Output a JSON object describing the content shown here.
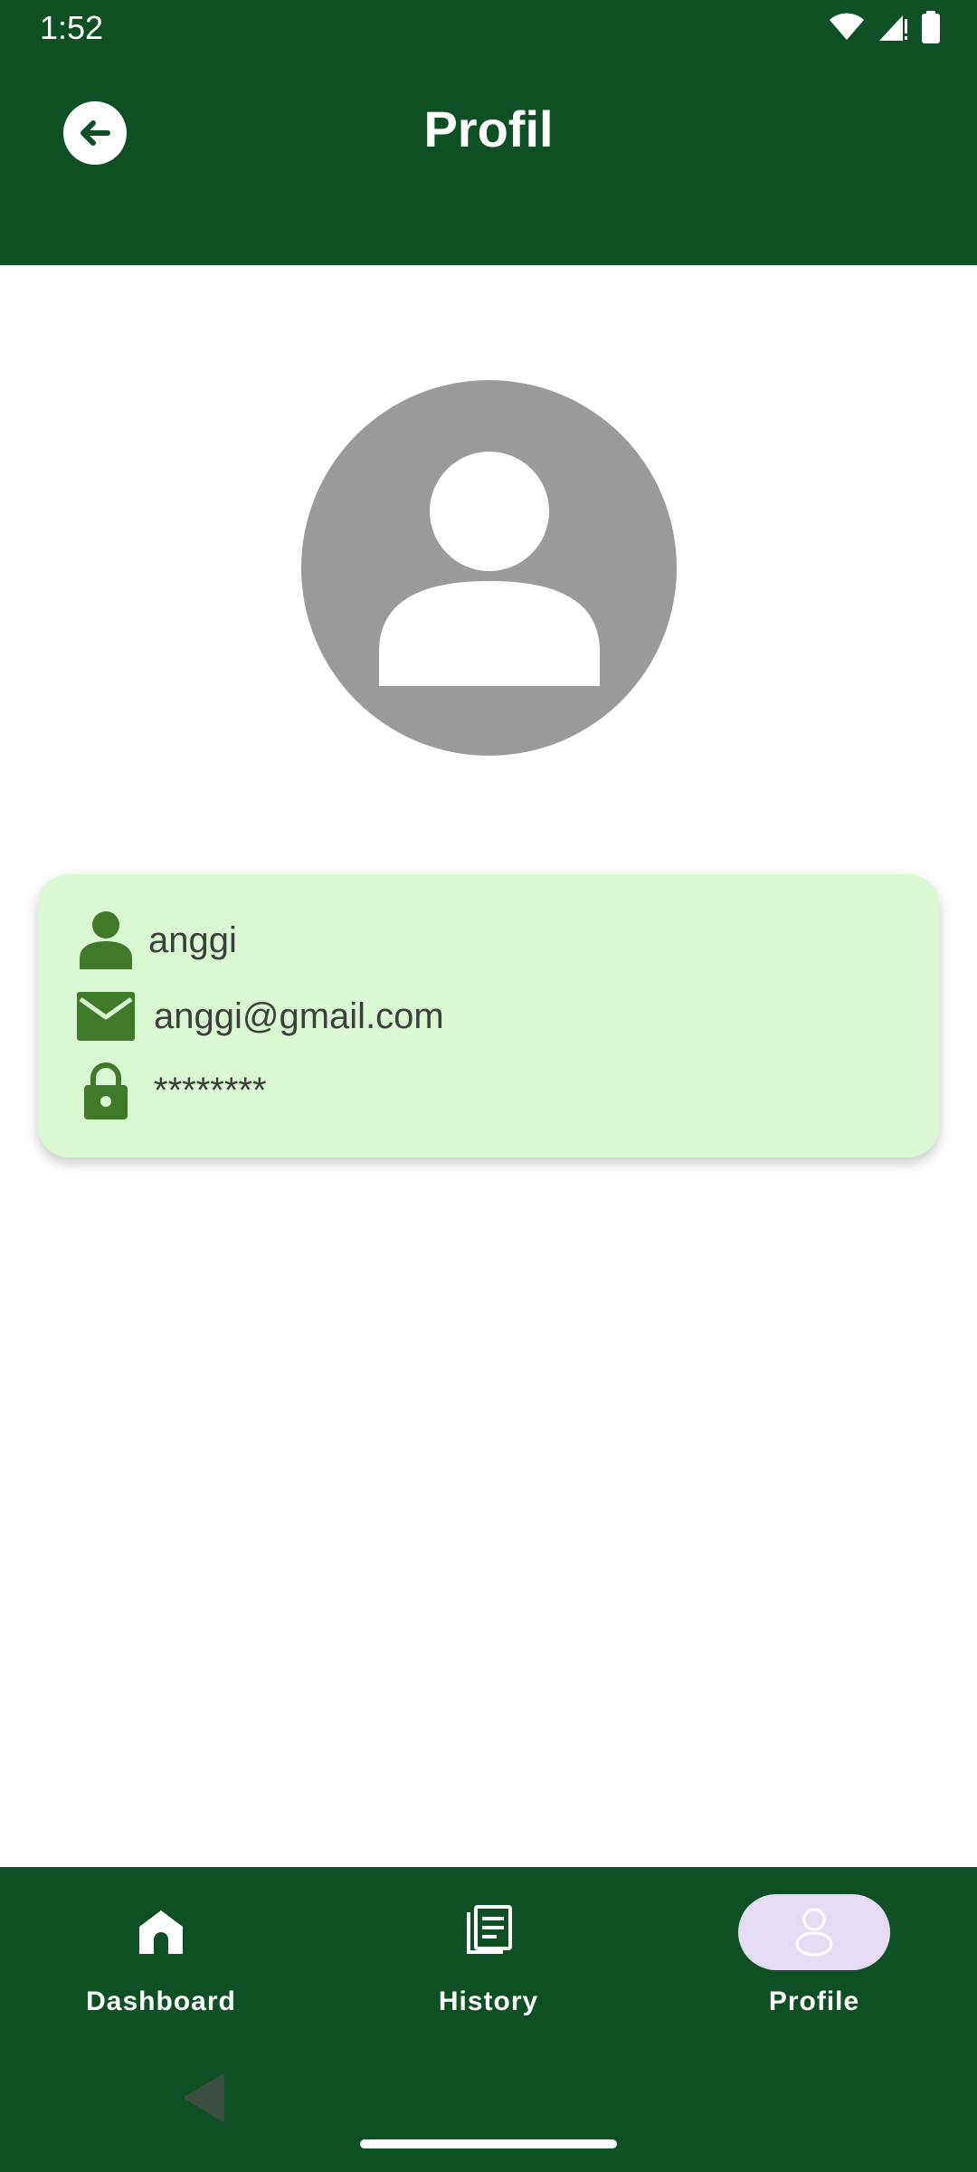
{
  "status_bar": {
    "time": "1:52"
  },
  "header": {
    "title": "Profil",
    "back_icon": "arrow-left-icon"
  },
  "avatar": {
    "icon": "person-placeholder-icon",
    "color": "#9a9a9a"
  },
  "profile": {
    "username": "anggi",
    "email": "anggi@gmail.com",
    "password": "********"
  },
  "bottom_nav": {
    "items": [
      {
        "label": "Dashboard",
        "icon": "home-icon",
        "active": false
      },
      {
        "label": "History",
        "icon": "history-icon",
        "active": false
      },
      {
        "label": "Profile",
        "icon": "profile-icon",
        "active": true
      }
    ]
  },
  "colors": {
    "primary": "#0e4f24",
    "card_background": "#d9f8d2",
    "icon_green": "#3f7a2a",
    "active_indicator": "#e5dcf4"
  }
}
